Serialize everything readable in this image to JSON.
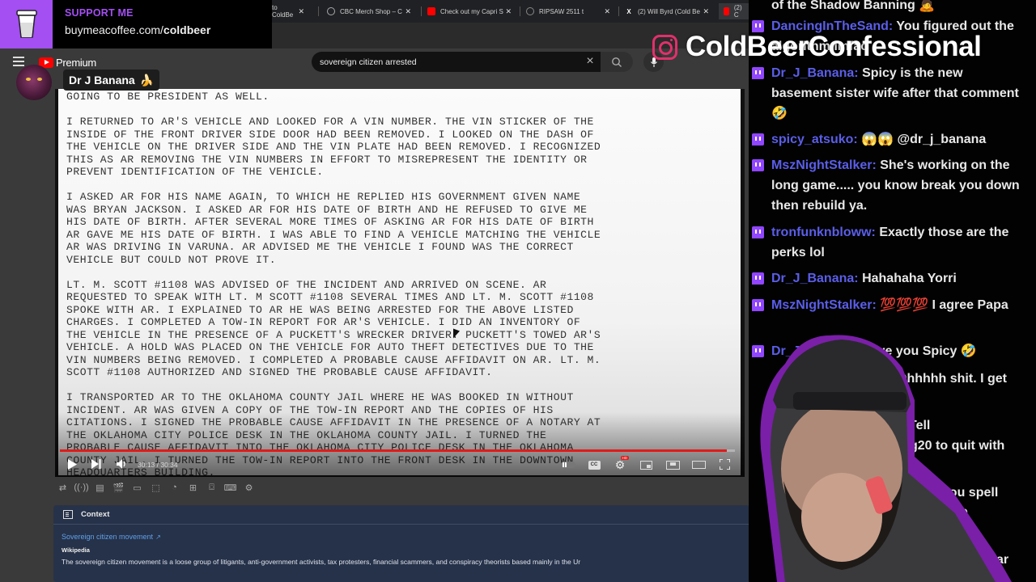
{
  "browser": {
    "tabs": [
      {
        "label": "to ColdBe",
        "icon": "partial-tab-icon"
      },
      {
        "label": "CBC Merch Shop – C",
        "icon": "shop-icon"
      },
      {
        "label": "Check out my Capri S",
        "icon": "youtube-icon"
      },
      {
        "label": "RIPSAW 2511 t",
        "icon": "loading-icon"
      },
      {
        "label": "(2) Will Byrd (Cold Be",
        "icon": "x-icon"
      },
      {
        "label": "(2) C",
        "icon": "youtube-icon"
      }
    ],
    "tab_close_glyph": "✕"
  },
  "support_overlay": {
    "title": "SUPPORT ME",
    "url_prefix": "buymeacoffee.com/",
    "url_suffix": "coldbeer",
    "accent_color": "#a34ff2"
  },
  "youtube": {
    "logo_label": "Premium",
    "search": {
      "value": "sovereign citizen arrested",
      "placeholder": "Search"
    }
  },
  "comment_overlay": {
    "author": "Dr J Banana",
    "emoji": "🍌"
  },
  "video": {
    "document_paragraphs": [
      [
        "GOING TO BE PRESIDENT AS WELL."
      ],
      [
        "I RETURNED TO AR'S VEHICLE AND LOOKED FOR A VIN NUMBER. THE VIN STICKER OF THE",
        "INSIDE OF THE FRONT DRIVER SIDE DOOR HAD BEEN REMOVED. I LOOKED ON THE DASH OF",
        "THE VEHICLE ON THE DRIVER SIDE AND THE VIN PLATE HAD BEEN REMOVED. I RECOGNIZED",
        "THIS AS AR REMOVING THE VIN NUMBERS IN EFFORT TO MISREPRESENT THE IDENTITY OR",
        "PREVENT IDENTIFICATION OF THE VEHICLE."
      ],
      [
        "I ASKED AR FOR HIS NAME AGAIN, TO WHICH HE REPLIED HIS GOVERNMENT GIVEN NAME",
        "WAS BRYAN JACKSON. I ASKED AR FOR HIS DATE OF BIRTH AND HE REFUSED TO GIVE ME",
        "HIS DATE OF BIRTH. AFTER SEVERAL MORE TIMES OF ASKING AR FOR HIS DATE OF BIRTH",
        "AR GAVE ME HIS DATE OF BIRTH. I WAS ABLE TO FIND A VEHICLE MATCHING THE VEHICLE",
        "AR WAS DRIVING IN VARUNA. AR ADVISED ME THE VEHICLE I FOUND WAS THE CORRECT",
        "VEHICLE BUT COULD NOT PROVE IT."
      ],
      [
        "LT. M. SCOTT #1108 WAS ADVISED OF THE INCIDENT AND ARRIVED ON SCENE. AR",
        "REQUESTED TO SPEAK WITH LT. M SCOTT #1108 SEVERAL TIMES AND LT. M. SCOTT #1108",
        "SPOKE WITH AR. I EXPLAINED TO AR HE WAS BEING ARRESTED FOR THE ABOVE LISTED",
        "CHARGES. I COMPLETED A TOW-IN REPORT FOR AR'S VEHICLE. I DID AN INVENTORY OF",
        "THE VEHICLE IN THE PRESENCE OF A PUCKETT'S WRECKER DRIVER. PUCKETT'S TOWED AR'S",
        "VEHICLE. A HOLD WAS PLACED ON THE VEHICLE FOR AUTO THEFT DETECTIVES DUE TO THE",
        "VIN NUMBERS BEING REMOVED. I COMPLETED A PROBABLE CAUSE AFFIDAVIT ON AR. LT. M.",
        "SCOTT #1108 AUTHORIZED AND SIGNED THE PROBABLE CAUSE AFFIDAVIT."
      ],
      [
        "I TRANSPORTED AR TO THE OKLAHOMA COUNTY JAIL WHERE HE WAS BOOKED IN WITHOUT",
        "INCIDENT. AR WAS GIVEN A COPY OF THE TOW-IN REPORT AND THE COPIES OF HIS",
        "CITATIONS. I SIGNED THE PROBABLE CAUSE AFFIDAVIT IN THE PRESENCE OF A NOTARY AT",
        "THE OKLAHOMA CITY POLICE DESK IN THE OKLAHOMA COUNTY JAIL. I TURNED THE",
        "PROBABLE CAUSE AFFIDAVIT INTO THE OKLAHOMA CITY POLICE DESK IN THE OKLAHOMA",
        "COUNTY JAIL. I TURNED THE TOW-IN REPORT INTO THE FRONT DESK IN THE DOWNTOWN",
        "HEADQUARTERS BUILDING."
      ]
    ],
    "time_current": "30:13",
    "time_total": "30:34",
    "time_display": "30:13 / 30:34",
    "progress_fraction": 0.988,
    "progress_color": "#e01b1b",
    "quality_badge": "HD"
  },
  "extension_toolbar": [
    {
      "name": "loop-icon",
      "glyph": "⇄"
    },
    {
      "name": "broadcast-icon",
      "glyph": "((·))"
    },
    {
      "name": "playlist-view-icon",
      "glyph": "▤"
    },
    {
      "name": "clapper-icon",
      "glyph": "🎬"
    },
    {
      "name": "aspect-icon",
      "glyph": "▭"
    },
    {
      "name": "dashed-frame-icon",
      "glyph": "⬚"
    },
    {
      "name": "speed-icon",
      "glyph": "◔"
    },
    {
      "name": "add-frame-icon",
      "glyph": "⊞"
    },
    {
      "name": "screenshot-icon",
      "glyph": "⌼"
    },
    {
      "name": "keyboard-icon",
      "glyph": "⌨"
    },
    {
      "name": "settings-gear-icon",
      "glyph": "⚙"
    }
  ],
  "context_panel": {
    "title": "Context",
    "link_text": "Sovereign citizen movement",
    "source": "Wikipedia",
    "body": "The sovereign citizen movement is a loose group of litigants, anti-government activists, tax protesters, financial scammers, and conspiracy theorists based mainly in the Ur"
  },
  "brand_overlay": {
    "name": "ColdBeerConfessional",
    "instagram_color": "#e1306c"
  },
  "chat": {
    "messages": [
      {
        "user": "",
        "text": "of the Shadow Banning 🙇"
      },
      {
        "user": "DancingInTheSand",
        "text": "You figured out the algorithm lmfao"
      },
      {
        "user": "Dr_J_Banana",
        "text": "Spicy is the new basement sister wife after that comment 🤣"
      },
      {
        "user": "spicy_atsuko",
        "text": "😱😱 @dr_j_banana"
      },
      {
        "user": "MszNightStalker",
        "text": "She's working on the long game..... you know break you down then rebuild ya."
      },
      {
        "user": "tronfunknbloww",
        "text": "Exactly those are the perks lol"
      },
      {
        "user": "Dr_J_Banana",
        "text": "Hahahaha Yorri"
      },
      {
        "user": "MszNightStalker",
        "text": "💯💯💯 I agree Papa"
      },
      {
        "user": "Dr_J_Banana",
        "text": "Love you Spicy 🤣"
      },
      {
        "user": "",
        "text": "Ohhhhh shit. I get"
      },
      {
        "user": "",
        "text": "Tell"
      },
      {
        "user": "",
        "text": "g20 to quit with"
      },
      {
        "user": "",
        "text": "l can you spell"
      },
      {
        "user": "",
        "text": "earl white"
      },
      {
        "user": "",
        "text": "potus ar"
      }
    ],
    "username_color": "#5b5ee8",
    "badge_color": "#9146ff"
  }
}
